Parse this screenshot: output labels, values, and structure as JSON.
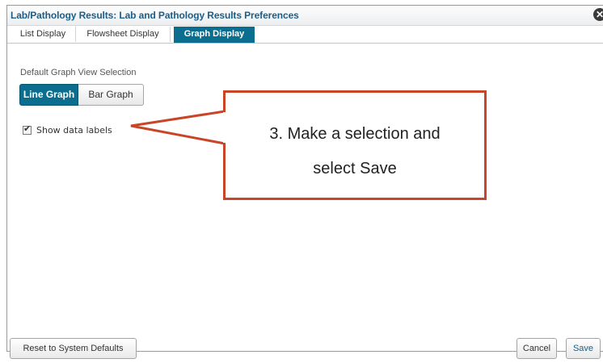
{
  "dialog": {
    "title": "Lab/Pathology Results: Lab and Pathology Results Preferences",
    "close_icon": "close-icon"
  },
  "tabs": [
    {
      "label": "List Display",
      "active": false
    },
    {
      "label": "Flowsheet Display",
      "active": false
    },
    {
      "label": "Graph Display",
      "active": true
    }
  ],
  "graph_settings": {
    "section_label": "Default Graph View Selection",
    "options": [
      {
        "label": "Line Graph",
        "selected": true
      },
      {
        "label": "Bar Graph",
        "selected": false
      }
    ],
    "show_data_labels": {
      "label": "Show data labels",
      "checked": true
    }
  },
  "footer": {
    "reset_label": "Reset to System Defaults",
    "cancel_label": "Cancel",
    "save_label": "Save"
  },
  "callout": {
    "text": "3. Make a selection and\nselect Save",
    "border_color": "#c94528"
  },
  "colors": {
    "accent": "#0c6e8f",
    "title": "#1b5e8a"
  }
}
